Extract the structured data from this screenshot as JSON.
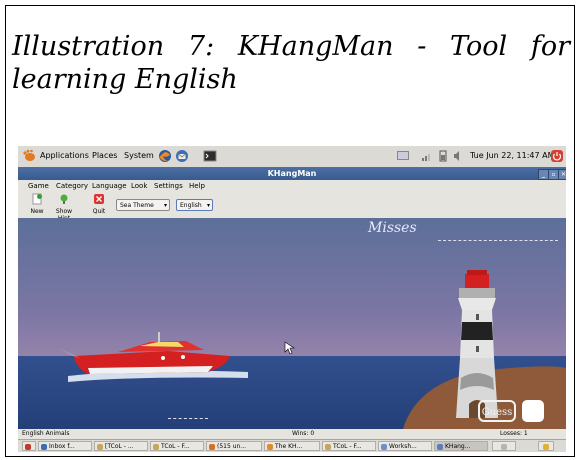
{
  "caption": "Illustration 7: KHangMan - Tool for learning English",
  "panel": {
    "applications": "Applications",
    "places": "Places",
    "system": "System",
    "clock": "Tue Jun 22, 11:47 AM"
  },
  "window": {
    "title": "KHangMan",
    "minimize": "_",
    "maximize": "▫",
    "close": "✕"
  },
  "menu": [
    "Game",
    "Category",
    "Language",
    "Look",
    "Settings",
    "Help"
  ],
  "toolbar": {
    "new": "New",
    "show_hint": "Show Hint",
    "quit": "Quit",
    "theme": "Sea Theme",
    "language": "English"
  },
  "game": {
    "misses_label": "Misses",
    "guess_label": "Guess"
  },
  "status": {
    "category": "English Animals",
    "wins": "Wins: 0",
    "losses": "Losses: 1"
  },
  "taskbar": [
    {
      "label": "Inbox f...",
      "color": "#3a6db4"
    },
    {
      "label": "[TCoL - ...",
      "color": "#c9a55b"
    },
    {
      "label": "TCoL - F...",
      "color": "#c9a55b"
    },
    {
      "label": "(515 un...",
      "color": "#d8701e"
    },
    {
      "label": "The KH...",
      "color": "#e08a2a"
    },
    {
      "label": "TCoL - F...",
      "color": "#c9a55b"
    },
    {
      "label": "Worksh...",
      "color": "#6b8fc9"
    },
    {
      "label": "KHang...",
      "color": "#5a7cc2"
    }
  ],
  "colors": {
    "titlebar": "#385b8f",
    "sky": "#7c76a4",
    "sea": "#2b4783",
    "island": "#8e5a3a"
  }
}
